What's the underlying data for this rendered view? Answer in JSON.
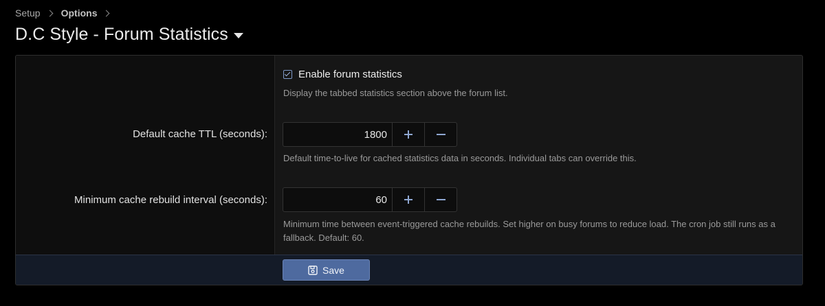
{
  "breadcrumb": {
    "items": [
      "Setup",
      "Options"
    ]
  },
  "header": {
    "title": "D.C Style - Forum Statistics"
  },
  "form": {
    "enable_stats": {
      "checked": true,
      "label": "Enable forum statistics",
      "hint": "Display the tabbed statistics section above the forum list."
    },
    "cache_ttl": {
      "label": "Default cache TTL (seconds):",
      "value": "1800",
      "hint": "Default time-to-live for cached statistics data in seconds. Individual tabs can override this."
    },
    "rebuild_interval": {
      "label": "Minimum cache rebuild interval (seconds):",
      "value": "60",
      "hint": "Minimum time between event-triggered cache rebuilds. Set higher on busy forums to reduce load. The cron job still runs as a fallback. Default: 60."
    }
  },
  "footer": {
    "save_label": "Save"
  },
  "icons": {
    "breadcrumb_separator": "chevron-right-icon",
    "title_menu": "caret-down-icon",
    "checkbox": "checkbox-checked-icon",
    "increment": "plus-icon",
    "decrement": "minus-icon",
    "save": "floppy-disk-icon"
  },
  "colors": {
    "background": "#000000",
    "panel": "#161616",
    "accent": "#4e6a9f",
    "footer": "#141b28"
  }
}
